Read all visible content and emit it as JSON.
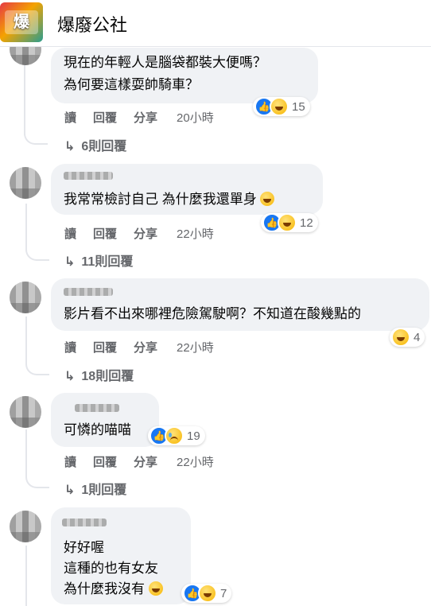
{
  "header": {
    "page_name": "爆廢公社"
  },
  "actions_labels": {
    "read": "讀",
    "reply": "回覆",
    "share": "分享"
  },
  "comments": [
    {
      "lines": [
        "現在的年輕人是腦袋都裝大便嗎？",
        "為何要這樣耍帥騎車？"
      ],
      "reaction_icons": [
        "like-icon",
        "haha-icon"
      ],
      "reaction_count": "15",
      "time": "20小時",
      "replies_label": "6則回覆"
    },
    {
      "lines": [
        "我常常檢討自己 為什麼我還單身"
      ],
      "reaction_icons": [
        "like-icon",
        "haha-icon"
      ],
      "reaction_count": "12",
      "time": "22小時",
      "replies_label": "11則回覆"
    },
    {
      "lines": [
        "影片看不出來哪裡危險駕駛啊？不知道在酸幾點的"
      ],
      "reaction_icons": [
        "haha-icon"
      ],
      "reaction_count": "4",
      "time": "22小時",
      "replies_label": "18則回覆"
    },
    {
      "lines": [
        "可憐的喵喵"
      ],
      "reaction_icons": [
        "like-icon",
        "sad-icon"
      ],
      "reaction_count": "19",
      "time": "22小時",
      "replies_label": "1則回覆"
    },
    {
      "lines": [
        "好好喔",
        "這種的也有女友",
        "為什麼我沒有"
      ],
      "reaction_icons": [
        "like-icon",
        "haha-icon"
      ],
      "reaction_count": "7"
    }
  ],
  "colors": {
    "bubble": "#f0f2f5",
    "secondary_text": "#65676b",
    "like_blue": "#1877f2"
  }
}
